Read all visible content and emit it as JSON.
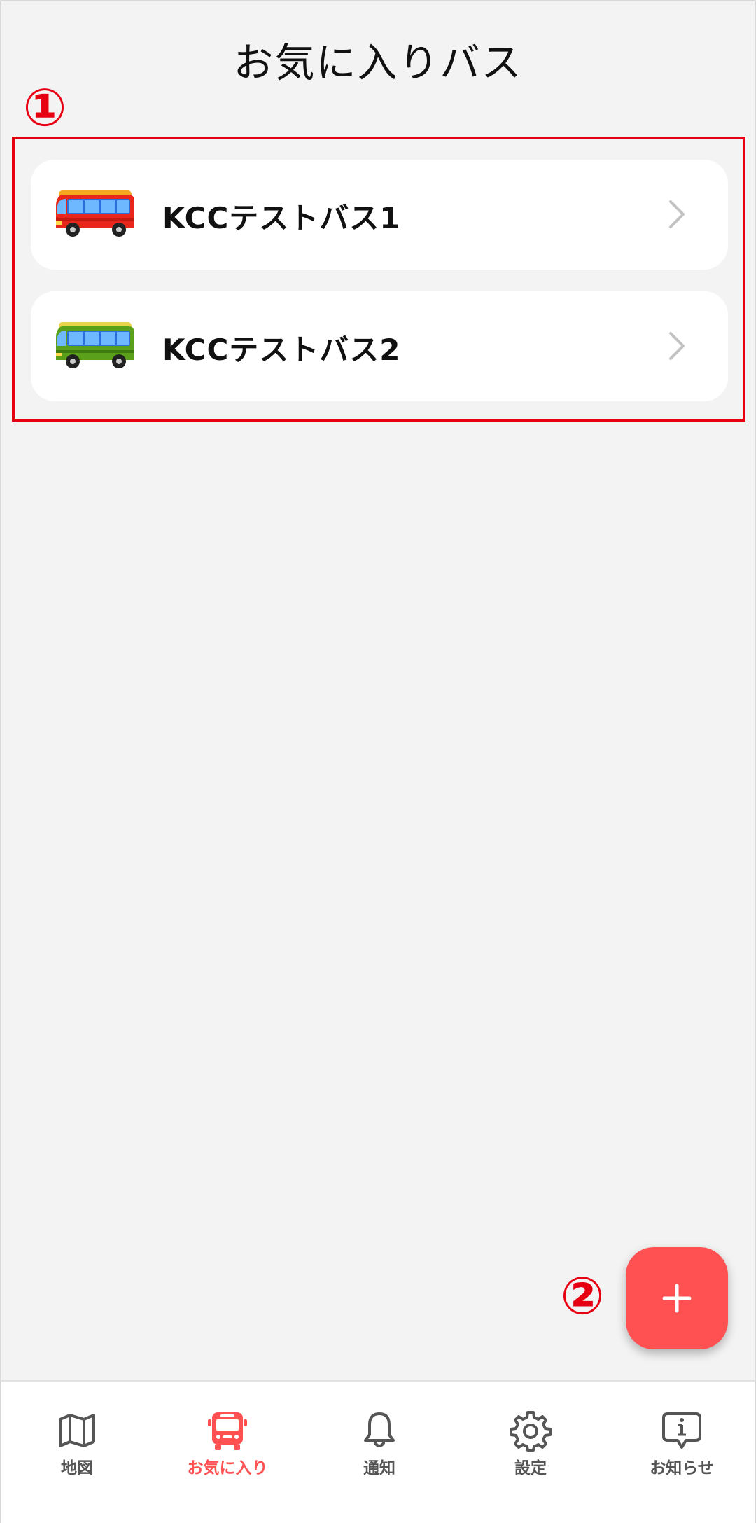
{
  "header": {
    "title": "お気に入りバス"
  },
  "annotations": {
    "callout_1": "①",
    "callout_2": "②"
  },
  "favorites": [
    {
      "name": "KCCテストバス1",
      "icon": "red-bus-icon",
      "color": "#e8261b"
    },
    {
      "name": "KCCテストバス2",
      "icon": "green-bus-icon",
      "color": "#5aa01a"
    }
  ],
  "fab": {
    "icon": "plus-icon",
    "color": "#ff5151"
  },
  "tabbar": {
    "tabs": [
      {
        "label": "地図",
        "icon": "map-icon",
        "active": false
      },
      {
        "label": "お気に入り",
        "icon": "bus-icon",
        "active": true
      },
      {
        "label": "通知",
        "icon": "bell-icon",
        "active": false
      },
      {
        "label": "設定",
        "icon": "gear-icon",
        "active": false
      },
      {
        "label": "お知らせ",
        "icon": "info-chat-icon",
        "active": false
      }
    ],
    "active_color": "#ff5151",
    "inactive_color": "#555555"
  },
  "colors": {
    "background": "#f3f3f3",
    "highlight": "#e60012"
  }
}
